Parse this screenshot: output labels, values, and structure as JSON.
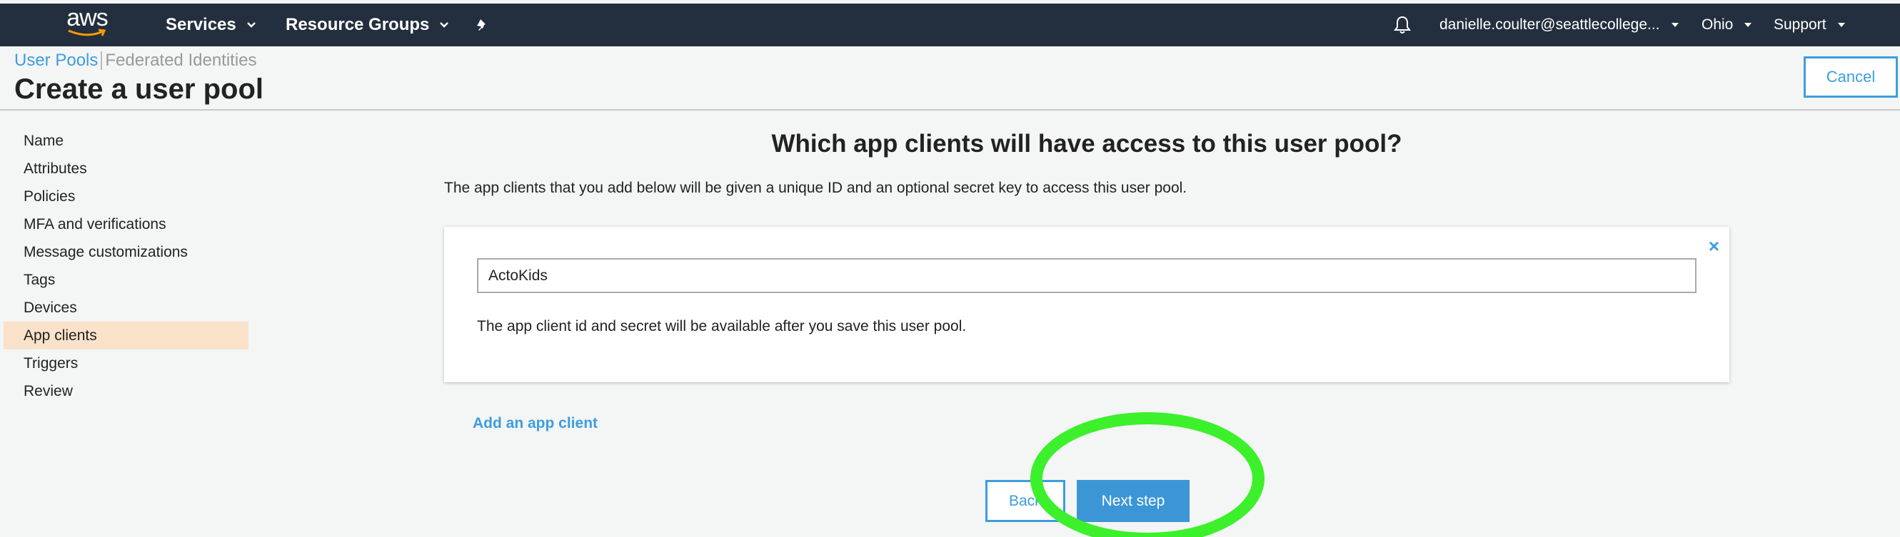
{
  "navbar": {
    "logo_text": "aws",
    "services_label": "Services",
    "resource_groups_label": "Resource Groups",
    "account_label": "danielle.coulter@seattlecollege...",
    "region_label": "Ohio",
    "support_label": "Support",
    "bg_color": "#232f3e"
  },
  "breadcrumb": {
    "user_pools": "User Pools",
    "federated": "Federated Identities"
  },
  "page": {
    "title": "Create a user pool",
    "cancel_label": "Cancel"
  },
  "sidebar": {
    "items": [
      {
        "label": "Name"
      },
      {
        "label": "Attributes"
      },
      {
        "label": "Policies"
      },
      {
        "label": "MFA and verifications"
      },
      {
        "label": "Message customizations"
      },
      {
        "label": "Tags"
      },
      {
        "label": "Devices"
      },
      {
        "label": "App clients",
        "active": true
      },
      {
        "label": "Triggers"
      },
      {
        "label": "Review"
      }
    ]
  },
  "main": {
    "heading": "Which app clients will have access to this user pool?",
    "description": "The app clients that you add below will be given a unique ID and an optional secret key to access this user pool.",
    "client_name_value": "ActoKids",
    "remove_icon": "×",
    "card_note": "The app client id and secret will be available after you save this user pool.",
    "add_client_label": "Add an app client",
    "back_label": "Back",
    "next_label": "Next step"
  },
  "colors": {
    "accent": "#3c9ee0",
    "active_nav": "#f9e2c9",
    "highlight": "#3cf02b"
  }
}
